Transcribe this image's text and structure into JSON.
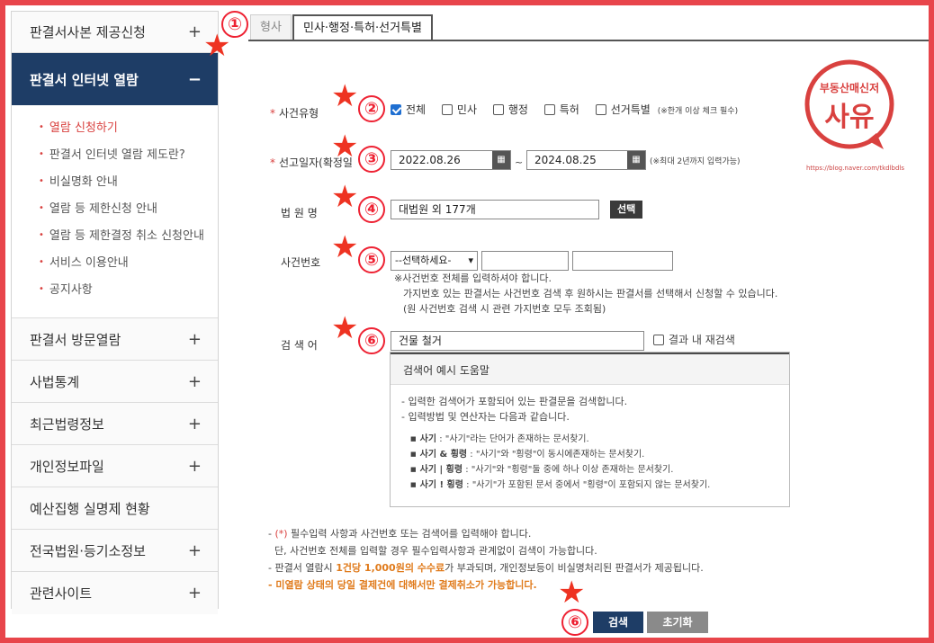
{
  "sidebar": {
    "items_top": [
      {
        "label": "판결서사본 제공신청",
        "toggle": "+"
      }
    ],
    "active": {
      "label": "판결서 인터넷 열람",
      "toggle": "−"
    },
    "submenu": [
      "열람 신청하기",
      "판결서 인터넷 열람 제도란?",
      "비실명화 안내",
      "열람 등 제한신청 안내",
      "열람 등 제한결정 취소 신청안내",
      "서비스 이용안내",
      "공지사항"
    ],
    "items_bottom": [
      {
        "label": "판결서 방문열람",
        "toggle": "+"
      },
      {
        "label": "사법통계",
        "toggle": "+"
      },
      {
        "label": "최근법령정보",
        "toggle": "+"
      },
      {
        "label": "개인정보파일",
        "toggle": "+"
      },
      {
        "label": "예산집행 실명제 현황",
        "toggle": ""
      },
      {
        "label": "전국법원·등기소정보",
        "toggle": "+"
      },
      {
        "label": "관련사이트",
        "toggle": "+"
      }
    ]
  },
  "tabs": [
    "형사",
    "민사·행정·특허·선거특별"
  ],
  "form": {
    "case_type": {
      "label": "사건유형",
      "options": [
        "전체",
        "민사",
        "행정",
        "특허",
        "선거특별"
      ],
      "note": "(※한개 이상 체크 필수)"
    },
    "date": {
      "label": "선고일자(확정일",
      "from": "2022.08.26",
      "sep": "~",
      "to": "2024.08.25",
      "note": "(※최대 2년까지 입력가능)",
      "cal_icon": "calendar-icon"
    },
    "court": {
      "label": "법 원 명",
      "value": "대법원 외 177개",
      "button": "선택"
    },
    "case_no": {
      "label": "사건번호",
      "select": "--선택하세요-",
      "notes": [
        "※사건번호 전체를 입력하셔야 합니다.",
        "가지번호 있는 판결서는 사건번호 검색 후 원하시는 판결서를 선택해서 신청할 수 있습니다.",
        "(원 사건번호 검색 시 관련 가지번호 모두 조회됨)"
      ]
    },
    "keyword": {
      "label": "검 색 어",
      "value": "건물 철거",
      "re_search": "결과 내 재검색"
    }
  },
  "help": {
    "title": "검색어 예시 도움말",
    "lines": [
      "- 입력한 검색어가 포함되어 있는 판결문을 검색합니다.",
      "- 입력방법 및 연산자는 다음과 같습니다."
    ],
    "examples": [
      {
        "term": "사기",
        "desc": ": \"사기\"라는 단어가 존재하는 문서찾기."
      },
      {
        "term": "사기 & 횡령",
        "desc": ": \"사기\"와 \"횡령\"이 동시에존재하는 문서찾기."
      },
      {
        "term": "사기 | 횡령",
        "desc": ": \"사기\"와 \"횡령\"둘 중에 하나 이상 존재하는 문서찾기."
      },
      {
        "term": "사기 ! 횡령",
        "desc": ": \"사기\"가 포함된 문서 중에서 \"횡령\"이 포함되지 않는 문서찾기."
      }
    ]
  },
  "footer": {
    "line1_prefix": "- ",
    "line1_req": "(*)",
    "line1": " 필수입력 사항과 사건번호 또는 검색어를 입력해야 합니다.",
    "line2": "  단, 사건번호 전체를 입력할 경우 필수입력사항과 관계없이 검색이 가능합니다.",
    "line3_a": "- 판결서 열람시 ",
    "line3_b": "1건당 1,000원의 수수료",
    "line3_c": "가 부과되며, 개인정보등이 비실명처리된 판결서가 제공됩니다.",
    "line4": "- 미열람 상태의 당일 결제건에 대해서만 결제취소가 가능합니다."
  },
  "buttons": {
    "search": "검색",
    "reset": "초기화"
  },
  "annotations": [
    "①",
    "②",
    "③",
    "④",
    "⑤",
    "⑥",
    "⑥"
  ],
  "logo": {
    "top": "부동산매신저",
    "main": "사유",
    "url": "https://blog.naver.com/tkdlbdls"
  },
  "colors": {
    "accent_navy": "#1e3d66",
    "annotation_red": "#e23333",
    "required": "#d9413f",
    "warning_orange": "#e07b1c"
  }
}
